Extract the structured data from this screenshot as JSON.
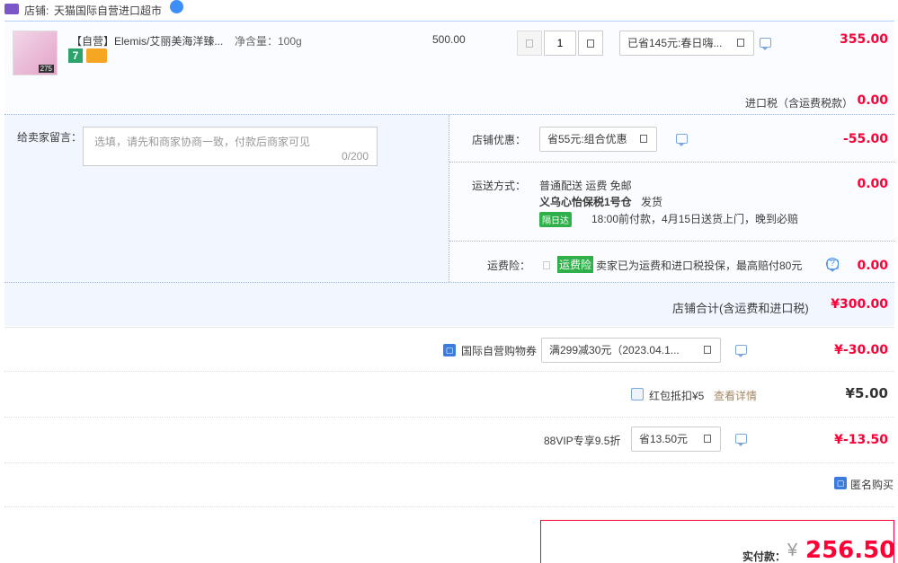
{
  "shop": {
    "label": "店铺:",
    "name": "天猫国际自营进口超市"
  },
  "product": {
    "title": "【自营】Elemis/艾丽美海洋臻...",
    "spec": "净含量：100g",
    "unit_price": "500.00",
    "quantity": "1",
    "discount_select": "已省145元:春日嗨...",
    "subtotal": "355.00",
    "badge_seven": "7",
    "thumb_label": "275"
  },
  "import_tax": {
    "label": "进口税（含运费税款）",
    "value": "0.00"
  },
  "message": {
    "label": "给卖家留言：",
    "placeholder": "选填，请先和商家协商一致，付款后商家可见",
    "counter": "0/200"
  },
  "shop_discount": {
    "label": "店铺优惠：",
    "select": "省55元:组合优惠",
    "value": "-55.00"
  },
  "shipping": {
    "label": "运送方式：",
    "method": "普通配送 运费 免邮",
    "warehouse": "义乌心怡保税1号仓",
    "ship_note": "发货",
    "badge": "隔日达",
    "schedule": "18:00前付款，4月15日送货上门，晚到必赔",
    "value": "0.00"
  },
  "insurance": {
    "label": "运费险：",
    "badge": "运费险",
    "text": "卖家已为运费和进口税投保，最高赔付80元",
    "value": "0.00"
  },
  "shop_total": {
    "label": "店铺合计(含运费和进口税)",
    "value": "¥300.00"
  },
  "coupon": {
    "label": "国际自营购物券",
    "select": "满299减30元（2023.04.1...",
    "value": "¥-30.00"
  },
  "redpacket": {
    "label": "红包抵扣¥5",
    "link": "查看详情",
    "value": "¥5.00"
  },
  "vip": {
    "label": "88VIP专享9.5折",
    "select": "省13.50元",
    "value": "¥-13.50"
  },
  "anonymous": {
    "label": "匿名购买"
  },
  "payment": {
    "label": "实付款：",
    "currency": "¥",
    "amount": "256.50"
  }
}
